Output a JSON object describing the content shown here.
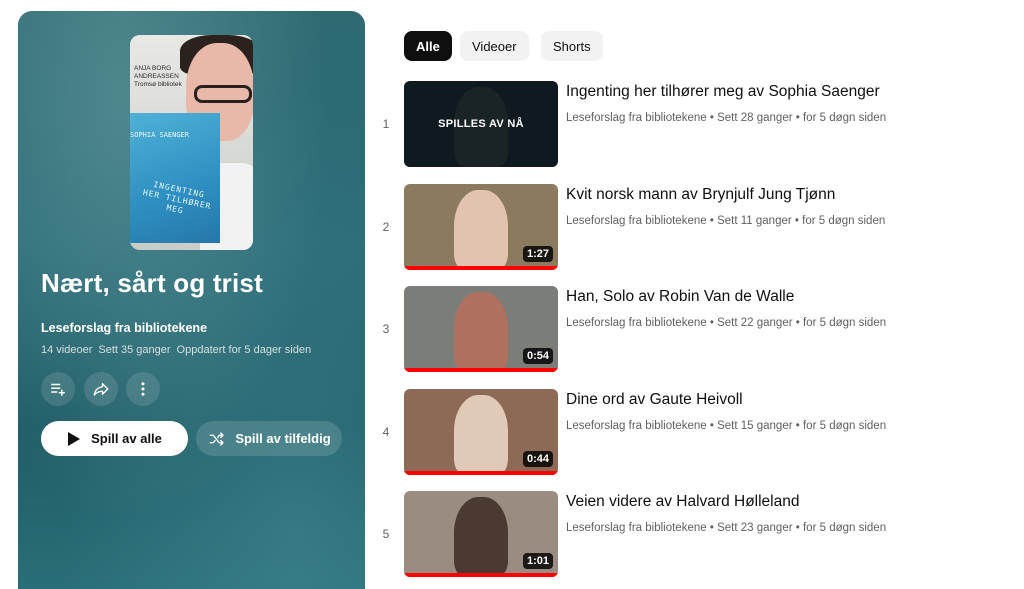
{
  "playlist": {
    "cover_text": {
      "tag": "ANJA BORG ANDREASSEN Tromsø bibliotek",
      "book_author": "SOPHIA SAENGER",
      "book_title": "INGENTING HER TILHØRER MEG"
    },
    "title": "Nært, sårt og trist",
    "owner": "Leseforslag fra bibliotekene",
    "video_count": "14 videoer",
    "views": "Sett 35 ganger",
    "updated": "Oppdatert for 5 dager siden",
    "play_all_label": "Spill av alle",
    "shuffle_label": "Spill av tilfeldig",
    "icons": [
      "add-to-queue-icon",
      "share-icon",
      "more-icon",
      "play-icon",
      "shuffle-icon"
    ]
  },
  "filters": {
    "chips": [
      {
        "label": "Alle",
        "active": true
      },
      {
        "label": "Videoer",
        "active": false
      },
      {
        "label": "Shorts",
        "active": false
      }
    ]
  },
  "videos": [
    {
      "index": "1",
      "title": "Ingenting her tilhører meg av Sophia Saenger",
      "channel": "Leseforslag fra bibliotekene",
      "views": "Sett 28 ganger",
      "age": "for 5 døgn siden",
      "overlay": "SPILLES AV NÅ",
      "duration": ""
    },
    {
      "index": "2",
      "title": "Kvit norsk mann av Brynjulf Jung Tjønn",
      "channel": "Leseforslag fra bibliotekene",
      "views": "Sett 11 ganger",
      "age": "for 5 døgn siden",
      "overlay": "",
      "duration": "1:27"
    },
    {
      "index": "3",
      "title": "Han, Solo av Robin Van de Walle",
      "channel": "Leseforslag fra bibliotekene",
      "views": "Sett 22 ganger",
      "age": "for 5 døgn siden",
      "overlay": "",
      "duration": "0:54"
    },
    {
      "index": "4",
      "title": "Dine ord av Gaute Heivoll",
      "channel": "Leseforslag fra bibliotekene",
      "views": "Sett 15 ganger",
      "age": "for 5 døgn siden",
      "overlay": "",
      "duration": "0:44"
    },
    {
      "index": "5",
      "title": "Veien videre av Halvard Hølleland",
      "channel": "Leseforslag fra bibliotekene",
      "views": "Sett 23 ganger",
      "age": "for 5 døgn siden",
      "overlay": "",
      "duration": "1:01"
    }
  ],
  "separator": "•"
}
